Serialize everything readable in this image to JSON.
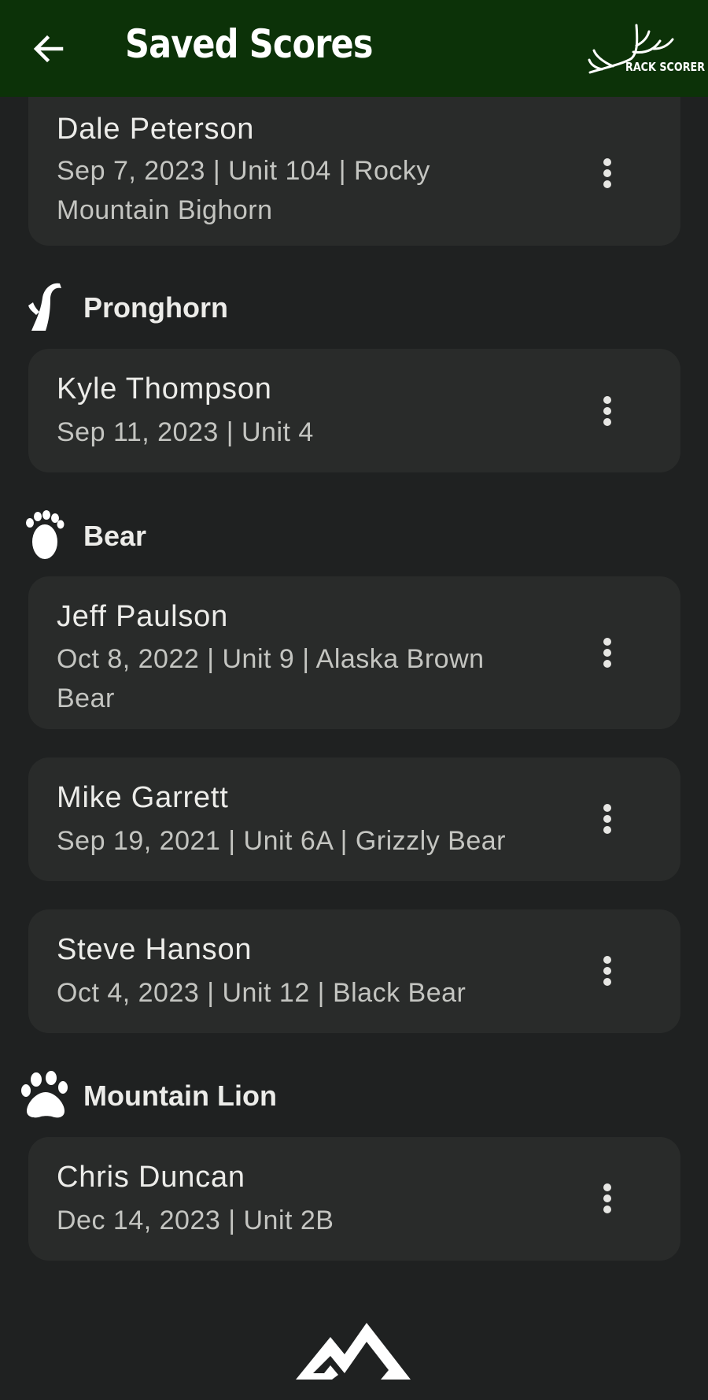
{
  "appbar": {
    "title": "Saved Scores",
    "back_icon": "arrow-left-icon",
    "brand_text": "RACK SCORER"
  },
  "groups": [
    {
      "entries": [
        {
          "name": "Dale Peterson",
          "meta": "Sep 7, 2023 | Unit 104 | Rocky Mountain Bighorn"
        }
      ]
    },
    {
      "label": "Pronghorn",
      "icon": "pronghorn-horn-icon",
      "entries": [
        {
          "name": "Kyle Thompson",
          "meta": "Sep 11, 2023 | Unit 4"
        }
      ]
    },
    {
      "label": "Bear",
      "icon": "bear-paw-icon",
      "entries": [
        {
          "name": "Jeff Paulson",
          "meta": "Oct 8, 2022 | Unit 9 | Alaska Brown Bear"
        },
        {
          "name": "Mike Garrett",
          "meta": "Sep 19, 2021 | Unit 6A | Grizzly Bear"
        },
        {
          "name": "Steve Hanson",
          "meta": "Oct 4, 2023 | Unit 12 | Black Bear"
        }
      ]
    },
    {
      "label": "Mountain Lion",
      "icon": "lion-paw-icon",
      "entries": [
        {
          "name": "Chris Duncan",
          "meta": "Dec 14, 2023 | Unit 2B"
        }
      ]
    }
  ],
  "theme": {
    "appbar_bg": "#0c3208",
    "page_bg": "#1f2121",
    "card_bg": "#292b2a",
    "text_primary": "#ecece9",
    "text_secondary": "#c4c5c1"
  }
}
